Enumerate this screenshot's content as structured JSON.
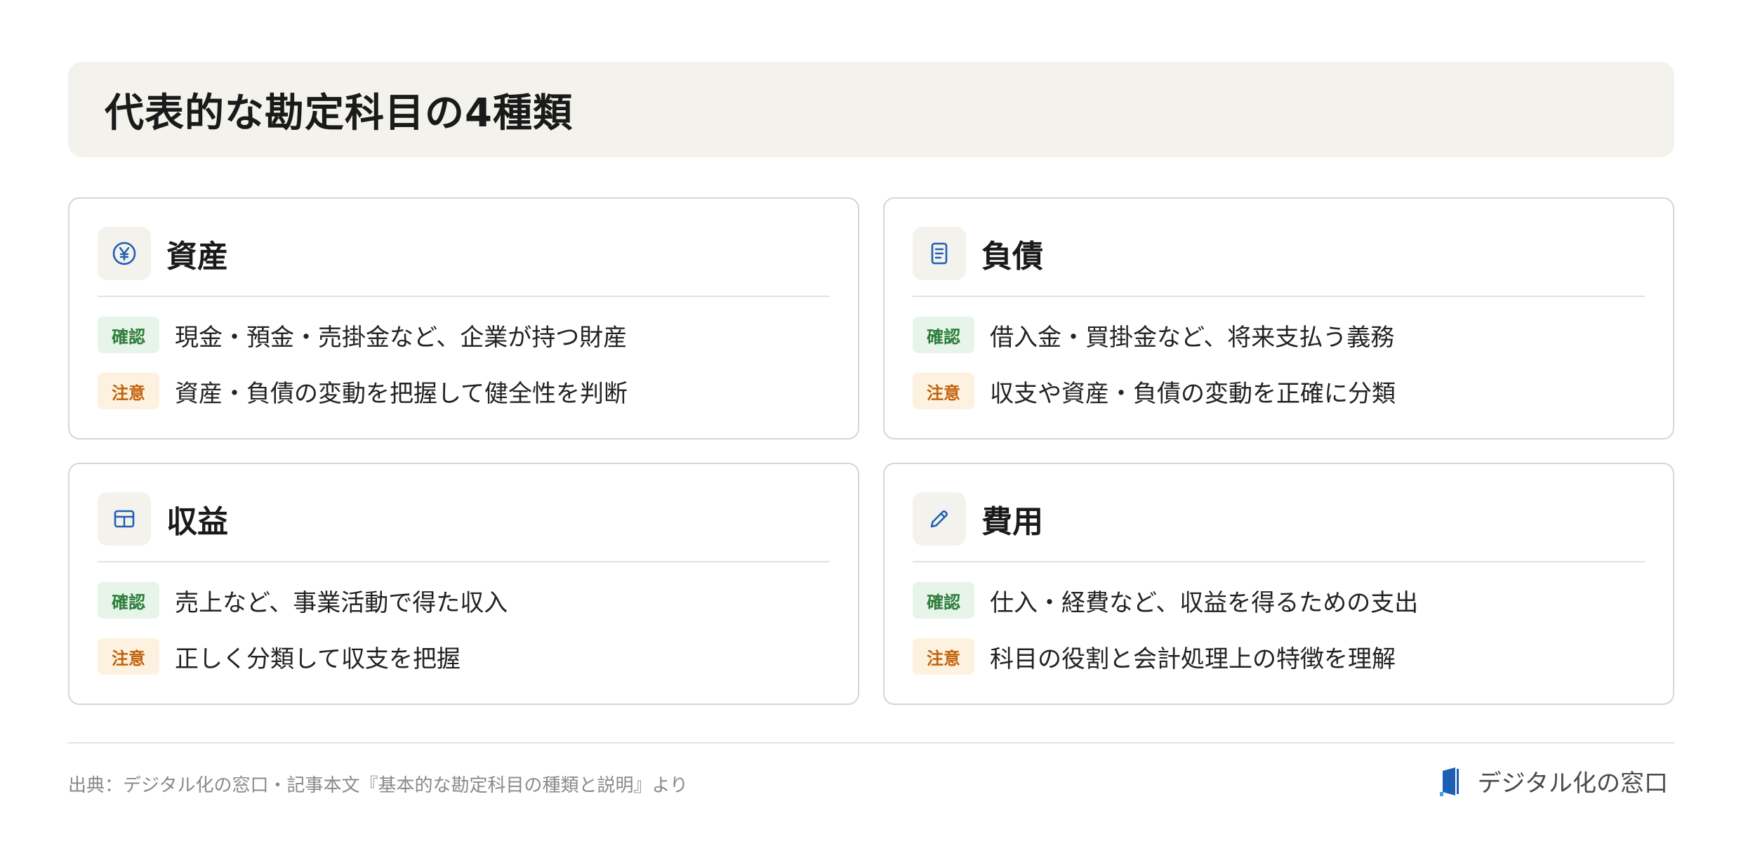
{
  "header": {
    "title": "代表的な勘定科目の4種類"
  },
  "cards": [
    {
      "title": "資産",
      "icon": "yen-circle-icon",
      "items": [
        {
          "badge": "確認",
          "text": "現金・預金・売掛金など、企業が持つ財産"
        },
        {
          "badge": "注意",
          "text": "資産・負債の変動を把握して健全性を判断"
        }
      ]
    },
    {
      "title": "負債",
      "icon": "document-icon",
      "items": [
        {
          "badge": "確認",
          "text": "借入金・買掛金など、将来支払う義務"
        },
        {
          "badge": "注意",
          "text": "収支や資産・負債の変動を正確に分類"
        }
      ]
    },
    {
      "title": "収益",
      "icon": "table-icon",
      "items": [
        {
          "badge": "確認",
          "text": "売上など、事業活動で得た収入"
        },
        {
          "badge": "注意",
          "text": "正しく分類して収支を把握"
        }
      ]
    },
    {
      "title": "費用",
      "icon": "pencil-icon",
      "items": [
        {
          "badge": "確認",
          "text": "仕入・経費など、収益を得るための支出"
        },
        {
          "badge": "注意",
          "text": "科目の役割と会計処理上の特徴を理解"
        }
      ]
    }
  ],
  "footer": {
    "source": "出典：デジタル化の窓口・記事本文『基本的な勘定科目の種類と説明』より",
    "brand_name": "デジタル化の窓口",
    "brand_icon": "window-logo-icon"
  },
  "colors": {
    "icon_accent": "#1e5fb4",
    "confirm_bg": "#e6f4ea",
    "confirm_text": "#2e7d3a",
    "caution_bg": "#fdf1e0",
    "caution_text": "#c2620a",
    "title_bar_bg": "#f4f2ed"
  }
}
